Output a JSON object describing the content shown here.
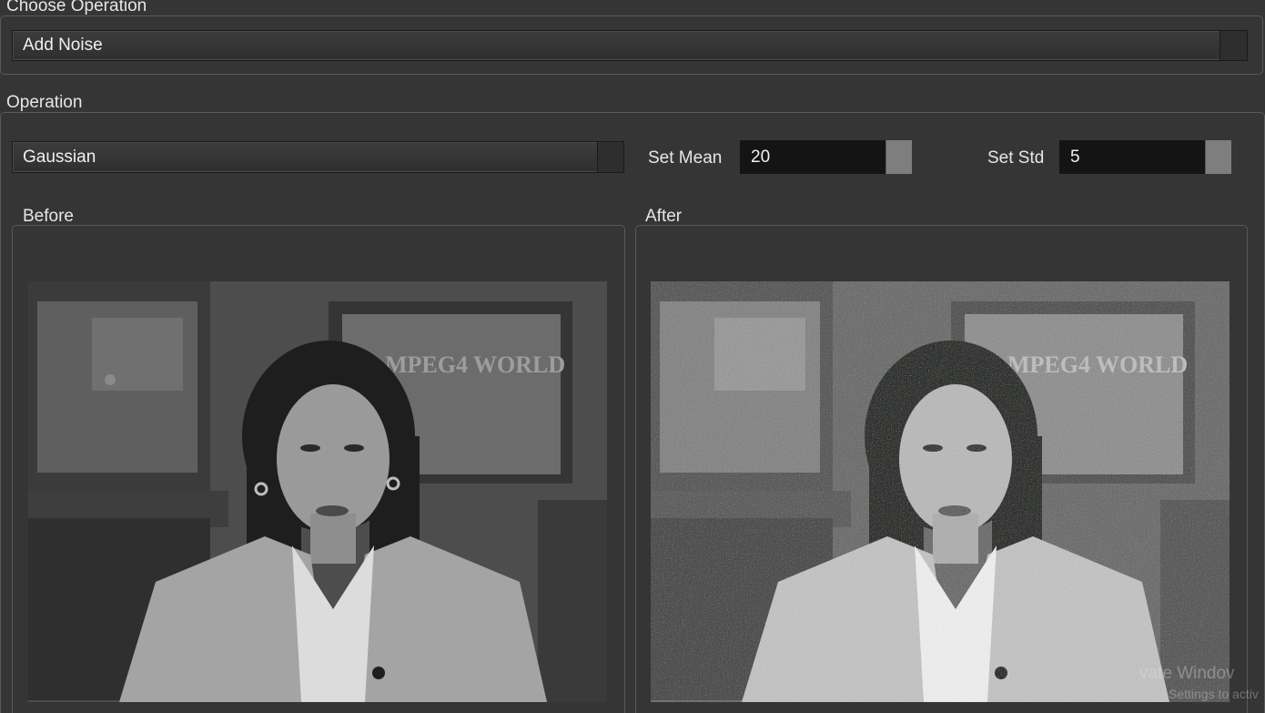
{
  "choose_operation": {
    "title": "Choose Operation",
    "selected": "Add Noise"
  },
  "operation": {
    "title": "Operation",
    "noise_type": "Gaussian",
    "mean": {
      "label": "Set Mean",
      "value": "20"
    },
    "std": {
      "label": "Set Std",
      "value": "5"
    }
  },
  "before": {
    "title": "Before",
    "image_caption": "MPEG4 WORLD"
  },
  "after": {
    "title": "After",
    "image_caption": "MPEG4 WORLD"
  },
  "watermark": {
    "line1": "vate Windov",
    "line2": "Settings to activ"
  },
  "icons": {
    "combo_arrow": "chevron-down-icon",
    "spin_button": "spin-arrows-icon"
  }
}
